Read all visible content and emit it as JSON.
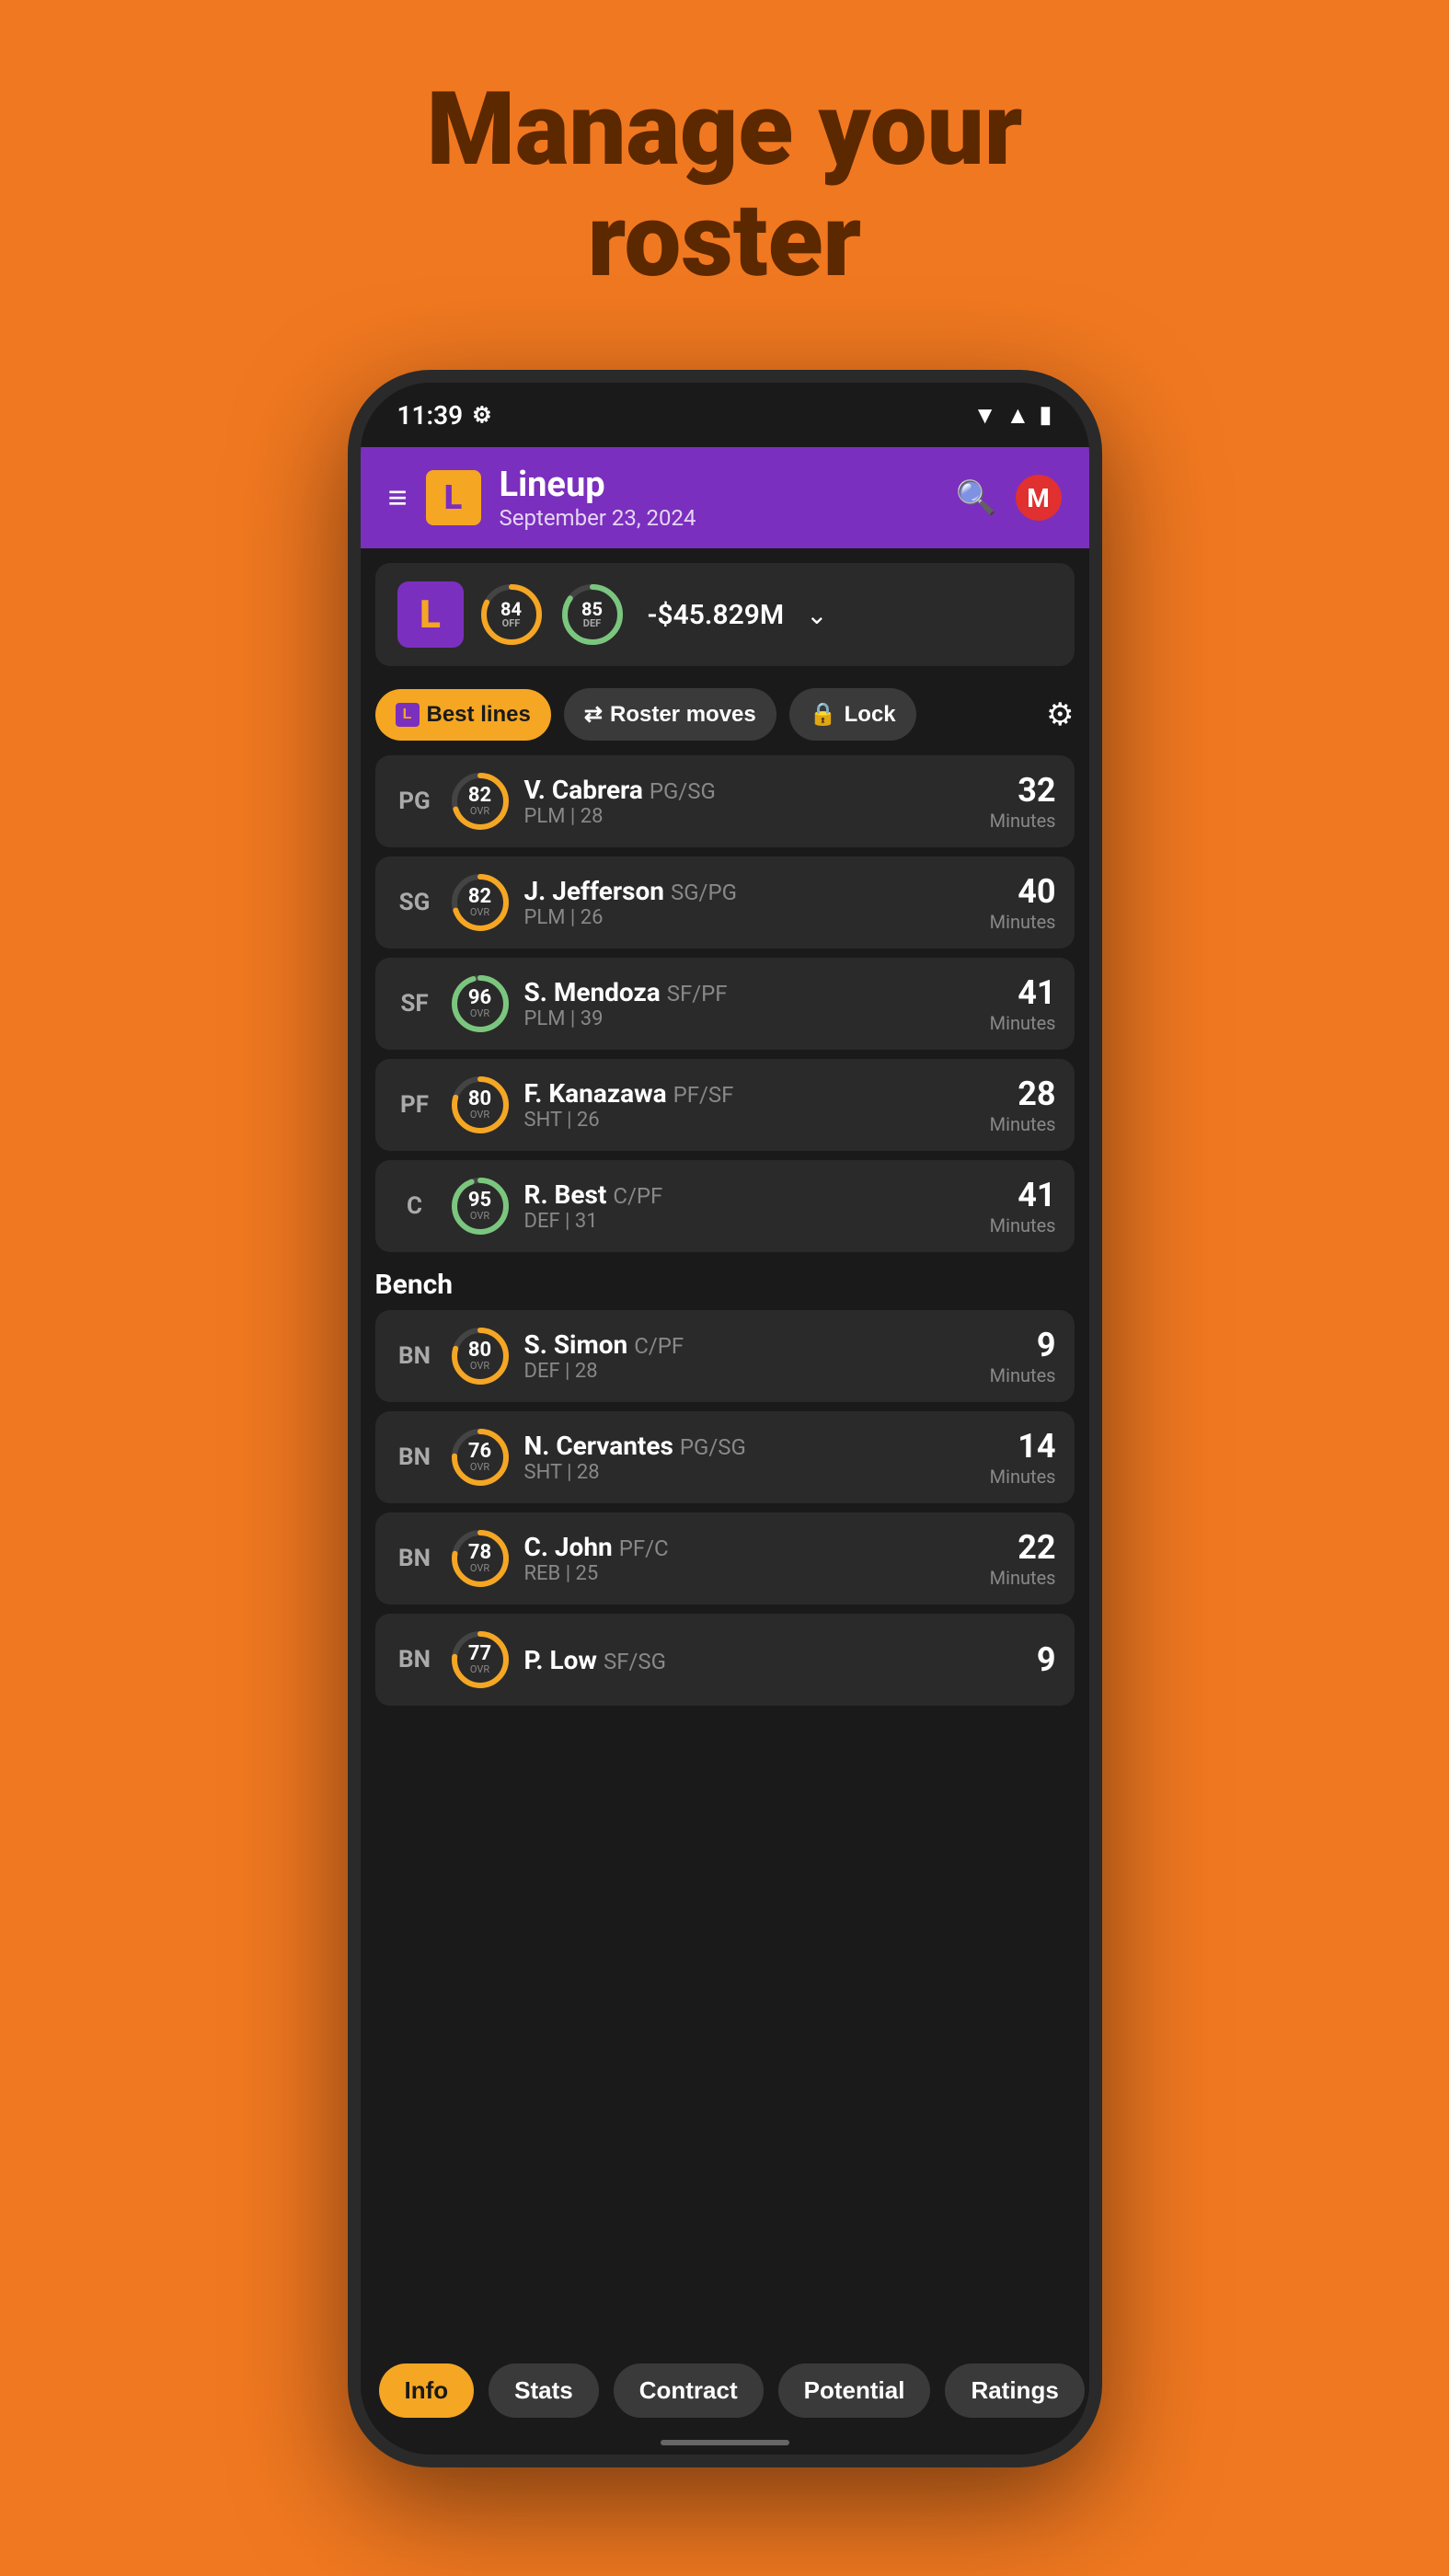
{
  "page": {
    "title_line1": "Manage your",
    "title_line2": "roster",
    "background_color": "#F07820",
    "title_color": "#5C2800"
  },
  "status_bar": {
    "time": "11:39",
    "icons": [
      "wifi",
      "signal",
      "battery"
    ]
  },
  "header": {
    "title": "Lineup",
    "subtitle": "September 23, 2024",
    "team_logo": "L",
    "search_label": "search",
    "profile_letter": "M"
  },
  "team_summary": {
    "logo": "L",
    "offense_rating": "84",
    "offense_label": "OFF",
    "defense_rating": "85",
    "defense_label": "DEF",
    "budget": "-$45.829M"
  },
  "action_buttons": {
    "best_lines": "Best lines",
    "roster_moves": "Roster moves",
    "lock": "Lock"
  },
  "starters": [
    {
      "position": "PG",
      "ovr": "82",
      "name": "V. Cabrera",
      "positions": "PG/SG",
      "team_contract": "PLM | 28",
      "minutes": "32"
    },
    {
      "position": "SG",
      "ovr": "82",
      "name": "J. Jefferson",
      "positions": "SG/PG",
      "team_contract": "PLM | 26",
      "minutes": "40"
    },
    {
      "position": "SF",
      "ovr": "96",
      "name": "S. Mendoza",
      "positions": "SF/PF",
      "team_contract": "PLM | 39",
      "minutes": "41"
    },
    {
      "position": "PF",
      "ovr": "80",
      "name": "F. Kanazawa",
      "positions": "PF/SF",
      "team_contract": "SHT | 26",
      "minutes": "28"
    },
    {
      "position": "C",
      "ovr": "95",
      "name": "R. Best",
      "positions": "C/PF",
      "team_contract": "DEF | 31",
      "minutes": "41"
    }
  ],
  "bench_header": "Bench",
  "bench": [
    {
      "position": "BN",
      "ovr": "80",
      "name": "S. Simon",
      "positions": "C/PF",
      "team_contract": "DEF | 28",
      "minutes": "9"
    },
    {
      "position": "BN",
      "ovr": "76",
      "name": "N. Cervantes",
      "positions": "PG/SG",
      "team_contract": "SHT | 28",
      "minutes": "14"
    },
    {
      "position": "BN",
      "ovr": "78",
      "name": "C. John",
      "positions": "PF/C",
      "team_contract": "REB | 25",
      "minutes": "22"
    },
    {
      "position": "BN",
      "ovr": "77",
      "name": "P. Low",
      "positions": "SF/SG",
      "team_contract": "",
      "minutes": "9"
    }
  ],
  "bottom_nav": {
    "tabs": [
      {
        "label": "Info",
        "active": true
      },
      {
        "label": "Stats",
        "active": false
      },
      {
        "label": "Contract",
        "active": false
      },
      {
        "label": "Potential",
        "active": false
      },
      {
        "label": "Ratings",
        "active": false
      }
    ]
  },
  "ovr_colors": {
    "95_plus": "#7BC67E",
    "80_plus": "#F5A623",
    "75_plus": "#F5A623",
    "bench": "#F5A623"
  }
}
